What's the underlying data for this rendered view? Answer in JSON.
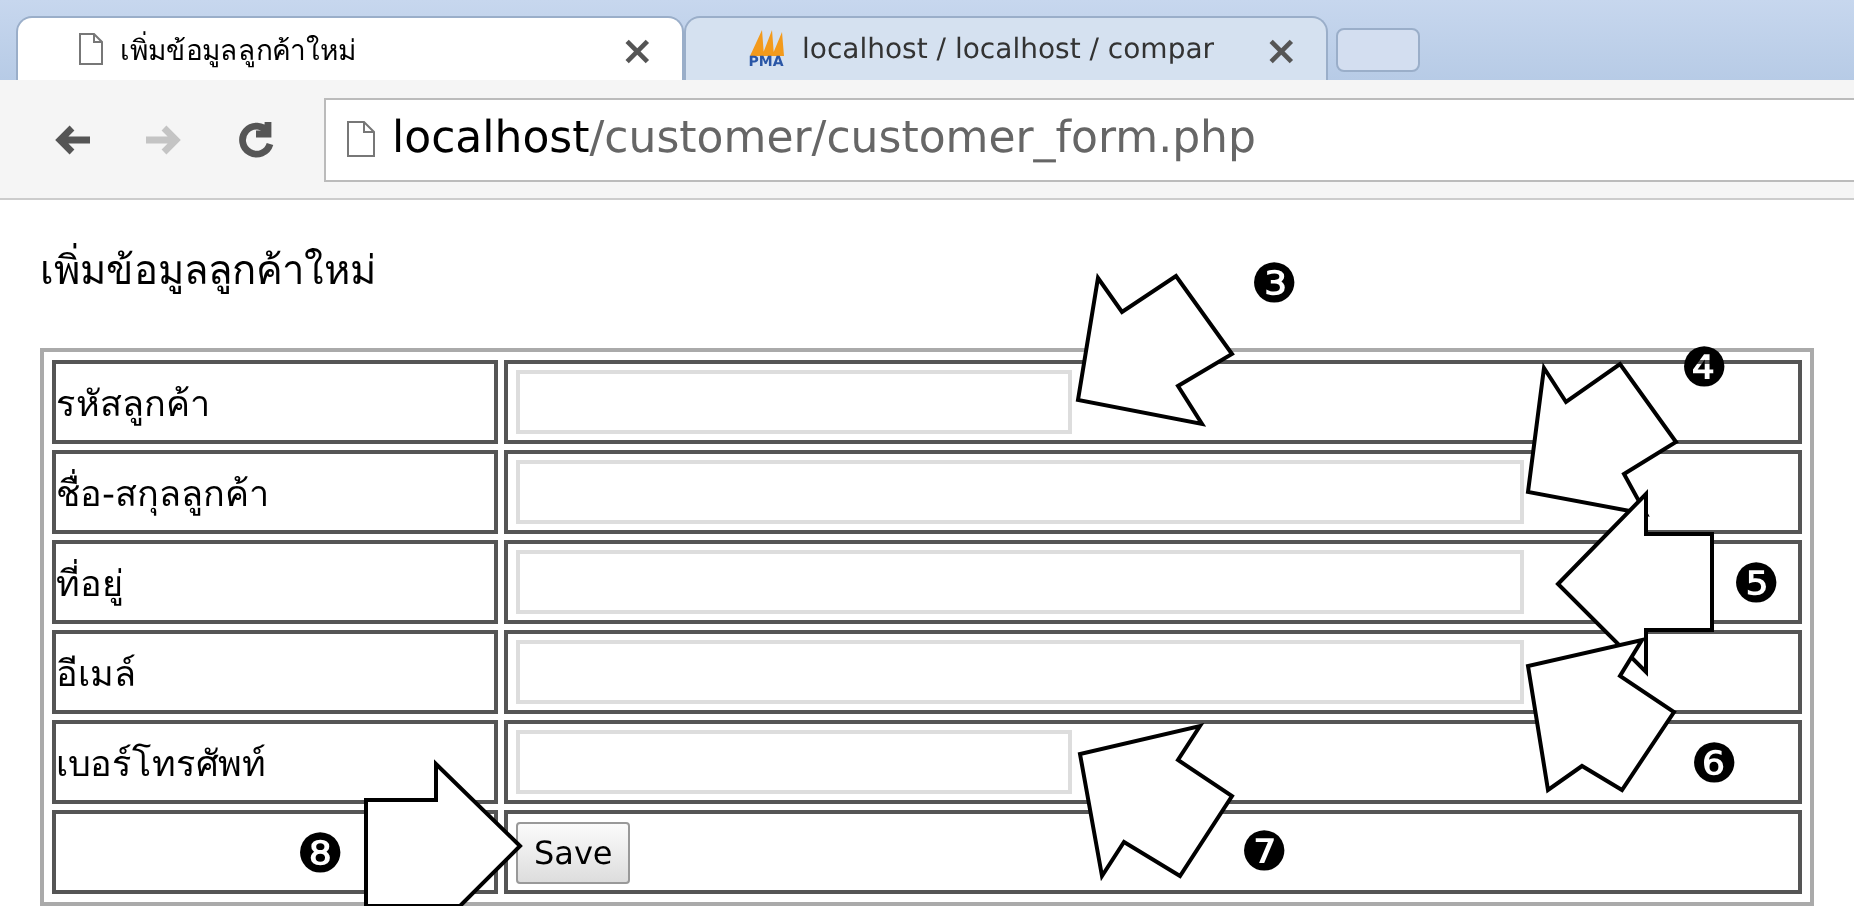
{
  "browser": {
    "tabs": [
      {
        "title": "เพิ่มข้อมูลลูกค้าใหม่",
        "selected": true,
        "kind": "page",
        "close": "×"
      },
      {
        "title": "localhost / localhost / compar",
        "selected": false,
        "kind": "logo",
        "logo_text": "PMA",
        "close": "×"
      }
    ],
    "nav": [
      {
        "kind": "back",
        "disabled": false
      },
      {
        "kind": "forward",
        "disabled": true
      },
      {
        "kind": "reload",
        "disabled": false
      }
    ],
    "address": {
      "host": "localhost",
      "path": "/customer/customer_form.php"
    }
  },
  "heading": "เพิ่มข้อมูลลูกค้าใหม่",
  "form": {
    "rows": [
      {
        "label": "รหัสลูกค้า",
        "kind": "short"
      },
      {
        "label": "ชื่อ-สกุลลูกค้า",
        "kind": "long"
      },
      {
        "label": "ที่อยู่",
        "kind": "long"
      },
      {
        "label": "อีเมล์",
        "kind": "long"
      },
      {
        "label": "เบอร์โทรศัพท์",
        "kind": "short"
      }
    ],
    "submit": "Save"
  },
  "callouts": [
    {
      "number": "❸"
    },
    {
      "number": "❹"
    },
    {
      "number": "❺"
    },
    {
      "number": "❻"
    },
    {
      "number": "❼"
    },
    {
      "number": "❽"
    }
  ]
}
